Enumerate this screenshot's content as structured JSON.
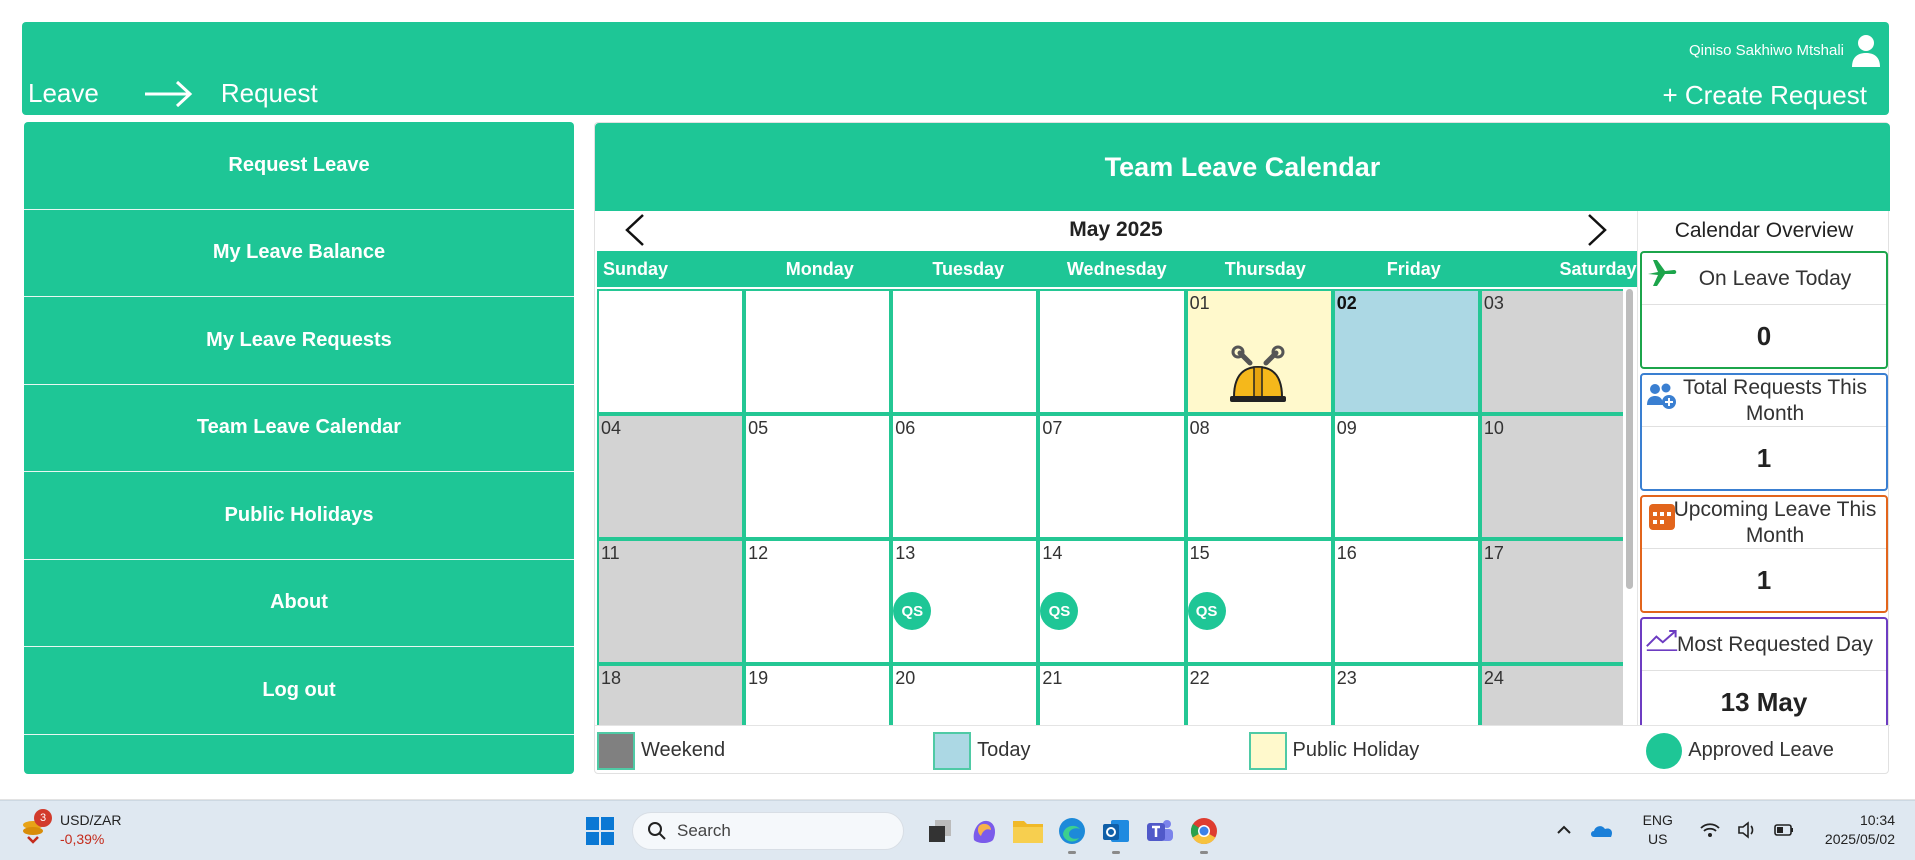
{
  "header": {
    "user_name": "Qiniso Sakhiwo Mtshali",
    "breadcrumb": [
      "Leave",
      "Request"
    ],
    "create_label": "+ Create Request"
  },
  "sidebar": {
    "items": [
      {
        "label": "Request Leave"
      },
      {
        "label": "My Leave Balance"
      },
      {
        "label": "My Leave Requests"
      },
      {
        "label": "Team Leave Calendar"
      },
      {
        "label": "Public Holidays"
      },
      {
        "label": "About"
      },
      {
        "label": "Log out"
      }
    ]
  },
  "main": {
    "title": "Team Leave Calendar",
    "month": "May 2025",
    "weekdays": [
      "Sunday",
      "Monday",
      "Tuesday",
      "Wednesday",
      "Thursday",
      "Friday",
      "Saturday"
    ],
    "weeks": [
      [
        {
          "num": "",
          "type": "blank"
        },
        {
          "num": "",
          "type": "blank"
        },
        {
          "num": "",
          "type": "blank"
        },
        {
          "num": "",
          "type": "blank"
        },
        {
          "num": "01",
          "type": "holiday"
        },
        {
          "num": "02",
          "type": "today"
        },
        {
          "num": "03",
          "type": "weekend"
        }
      ],
      [
        {
          "num": "04",
          "type": "weekend"
        },
        {
          "num": "05",
          "type": "normal"
        },
        {
          "num": "06",
          "type": "normal"
        },
        {
          "num": "07",
          "type": "normal"
        },
        {
          "num": "08",
          "type": "normal"
        },
        {
          "num": "09",
          "type": "normal"
        },
        {
          "num": "10",
          "type": "weekend"
        }
      ],
      [
        {
          "num": "11",
          "type": "weekend"
        },
        {
          "num": "12",
          "type": "normal"
        },
        {
          "num": "13",
          "type": "normal",
          "leave": "QS"
        },
        {
          "num": "14",
          "type": "normal",
          "leave": "QS"
        },
        {
          "num": "15",
          "type": "normal",
          "leave": "QS"
        },
        {
          "num": "16",
          "type": "normal"
        },
        {
          "num": "17",
          "type": "weekend"
        }
      ],
      [
        {
          "num": "18",
          "type": "weekend"
        },
        {
          "num": "19",
          "type": "normal"
        },
        {
          "num": "20",
          "type": "normal"
        },
        {
          "num": "21",
          "type": "normal"
        },
        {
          "num": "22",
          "type": "normal"
        },
        {
          "num": "23",
          "type": "normal"
        },
        {
          "num": "24",
          "type": "weekend"
        }
      ]
    ],
    "legend": [
      {
        "label": "Weekend",
        "color": "#808080"
      },
      {
        "label": "Today",
        "color": "#acd8e4"
      },
      {
        "label": "Public Holiday",
        "color": "#fff9cc"
      },
      {
        "label": "Approved Leave",
        "color": "#1ec696"
      }
    ]
  },
  "overview": {
    "title": "Calendar Overview",
    "cards": [
      {
        "label": "On Leave Today",
        "value": "0",
        "icon": "airplane-icon",
        "color": "#1ca54b"
      },
      {
        "label": "Total Requests This Month",
        "value": "1",
        "icon": "add-users-icon",
        "color": "#3a7fd1"
      },
      {
        "label": "Upcoming Leave This Month",
        "value": "1",
        "icon": "calendar-icon",
        "color": "#e2651c"
      },
      {
        "label": "Most Requested Day",
        "value": "13 May",
        "icon": "trend-up-icon",
        "color": "#6d3cc2"
      }
    ]
  },
  "taskbar": {
    "ticker_name": "USD/ZAR",
    "ticker_change": "-0,39%",
    "ticker_badge": "3",
    "search_placeholder": "Search",
    "lang_top": "ENG",
    "lang_bottom": "US",
    "time": "10:34",
    "date": "2025/05/02"
  }
}
